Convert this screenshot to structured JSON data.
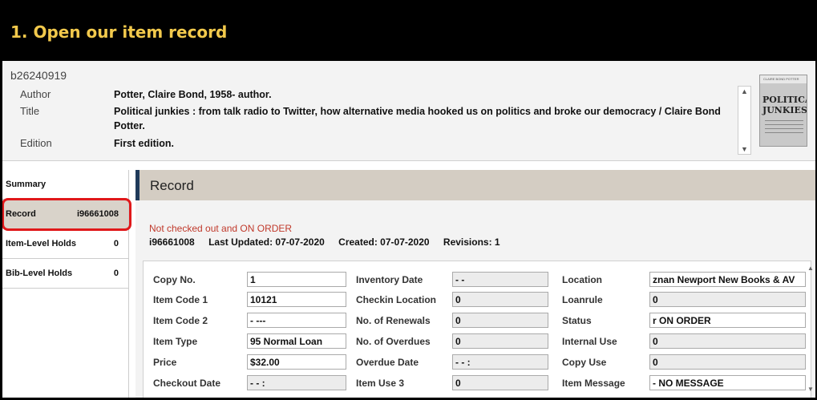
{
  "banner": {
    "title": "1. Open our item record"
  },
  "bib": {
    "number": "b26240919",
    "fields": [
      {
        "label": "Author",
        "value": "Potter, Claire Bond, 1958- author."
      },
      {
        "label": "Title",
        "value": "Political junkies : from talk radio to Twitter, how alternative media hooked us on politics and broke our democracy / Claire Bond Potter."
      },
      {
        "label": "Edition",
        "value": "First edition."
      }
    ],
    "cover": {
      "author": "CLAIRE BOND POTTER",
      "title": "POLITICAL JUNKIES"
    }
  },
  "sidebar": {
    "items": [
      {
        "label": "Summary",
        "value": ""
      },
      {
        "label": "Record",
        "value": "i96661008"
      },
      {
        "label": "Item-Level Holds",
        "value": "0"
      },
      {
        "label": "Bib-Level Holds",
        "value": "0"
      }
    ],
    "highlight_color": "#e0181a"
  },
  "record": {
    "heading": "Record",
    "status": "Not checked out and ON ORDER",
    "item_number": "i96661008",
    "last_updated": "Last Updated: 07-07-2020",
    "created": "Created: 07-07-2020",
    "revisions": "Revisions: 1",
    "fields": {
      "col1": [
        {
          "label": "Copy No.",
          "value": "1",
          "editable": true
        },
        {
          "label": "Item Code 1",
          "value": "10121",
          "editable": true
        },
        {
          "label": "Item Code 2",
          "value": "- ---",
          "editable": true
        },
        {
          "label": "Item Type",
          "value": "95 Normal Loan",
          "editable": true
        },
        {
          "label": "Price",
          "value": "$32.00",
          "editable": true
        },
        {
          "label": "Checkout Date",
          "value": "- -      :",
          "editable": false
        }
      ],
      "col2": [
        {
          "label": "Inventory Date",
          "value": "- -",
          "editable": false
        },
        {
          "label": "Checkin Location",
          "value": "0",
          "editable": false
        },
        {
          "label": "No. of Renewals",
          "value": "0",
          "editable": false
        },
        {
          "label": "No. of Overdues",
          "value": "0",
          "editable": false
        },
        {
          "label": "Overdue Date",
          "value": "- -      :",
          "editable": false
        },
        {
          "label": "Item Use 3",
          "value": "0",
          "editable": false
        }
      ],
      "col3": [
        {
          "label": "Location",
          "value": "znan   Newport New Books & AV",
          "editable": true
        },
        {
          "label": "Loanrule",
          "value": "0",
          "editable": false
        },
        {
          "label": "Status",
          "value": "r    ON ORDER",
          "editable": true
        },
        {
          "label": "Internal Use",
          "value": "0",
          "editable": false
        },
        {
          "label": "Copy Use",
          "value": "0",
          "editable": false
        },
        {
          "label": "Item Message",
          "value": "-  NO MESSAGE",
          "editable": true
        }
      ]
    }
  }
}
